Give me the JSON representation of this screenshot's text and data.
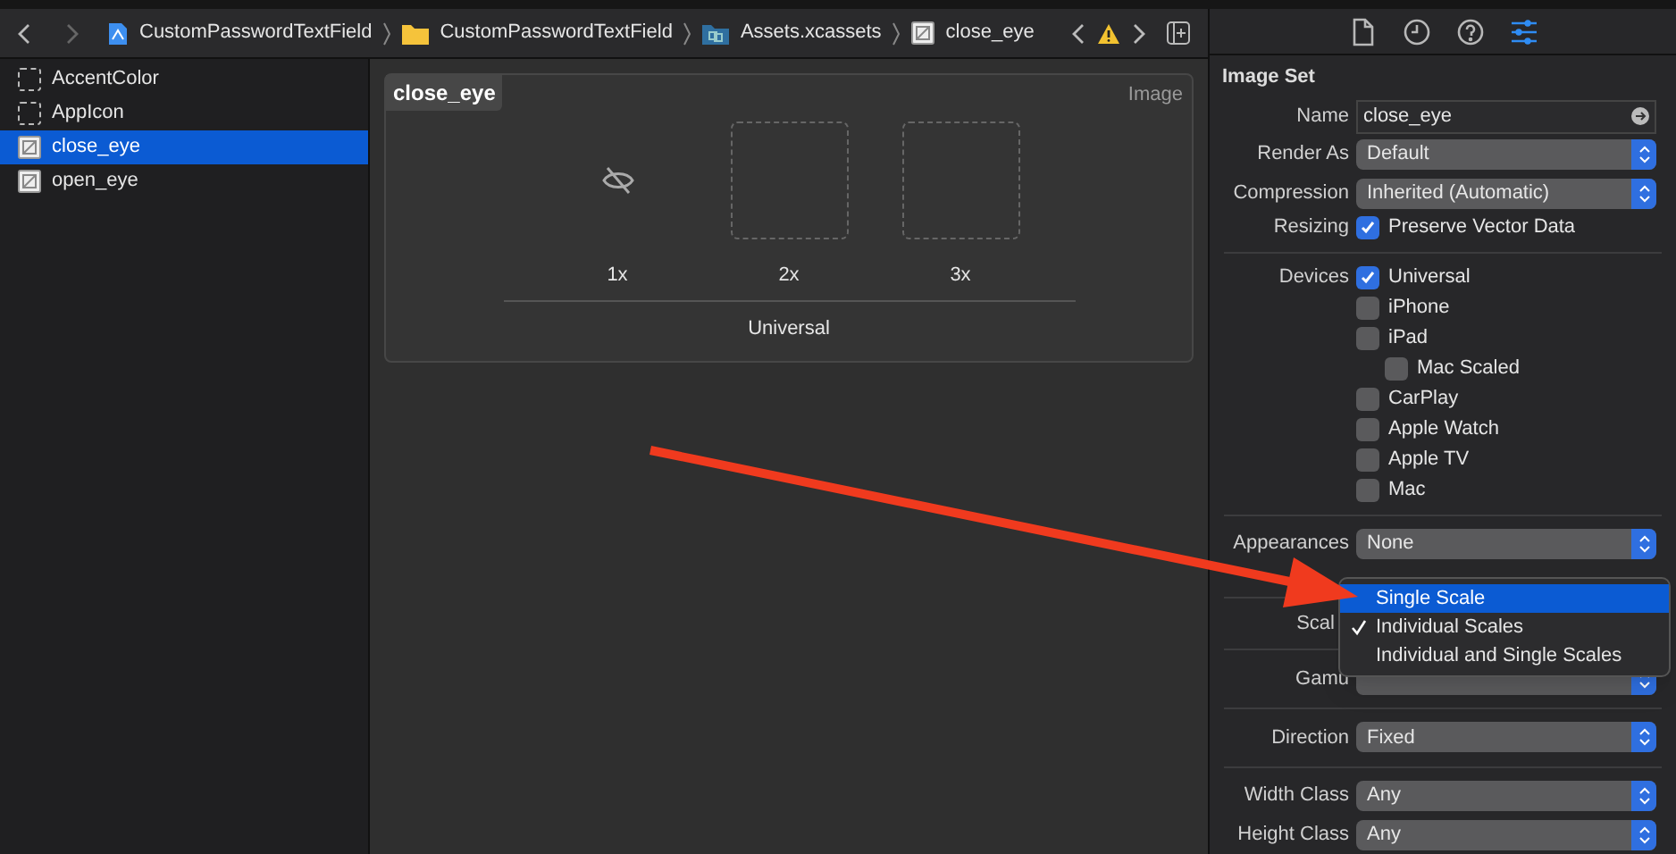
{
  "breadcrumb": [
    {
      "label": "CustomPasswordTextField",
      "kind": "project"
    },
    {
      "label": "CustomPasswordTextField",
      "kind": "folder"
    },
    {
      "label": "Assets.xcassets",
      "kind": "assets"
    },
    {
      "label": "close_eye",
      "kind": "image"
    }
  ],
  "sidebar": {
    "items": [
      {
        "label": "AccentColor",
        "kind": "empty",
        "selected": false
      },
      {
        "label": "AppIcon",
        "kind": "empty",
        "selected": false
      },
      {
        "label": "close_eye",
        "kind": "image",
        "selected": true
      },
      {
        "label": "open_eye",
        "kind": "image",
        "selected": false
      }
    ]
  },
  "editor": {
    "set_name": "close_eye",
    "type_label": "Image",
    "slots": [
      {
        "label": "1x",
        "filled": true
      },
      {
        "label": "2x",
        "filled": false
      },
      {
        "label": "3x",
        "filled": false
      }
    ],
    "group_label": "Universal"
  },
  "inspector": {
    "tabs": [
      {
        "kind": "file",
        "selected": false
      },
      {
        "kind": "history",
        "selected": false
      },
      {
        "kind": "help",
        "selected": false
      },
      {
        "kind": "attributes",
        "selected": true
      }
    ],
    "title": "Image Set",
    "rows": [
      {
        "kind": "field",
        "label": "Name",
        "value": "close_eye"
      },
      {
        "kind": "popup",
        "label": "Render As",
        "value": "Default"
      },
      {
        "kind": "popup",
        "label": "Compression",
        "value": "Inherited (Automatic)"
      },
      {
        "kind": "checkbox",
        "label": "Resizing",
        "text": "Preserve Vector Data",
        "checked": true
      },
      {
        "kind": "divider"
      },
      {
        "kind": "checkbox",
        "label": "Devices",
        "text": "Universal",
        "checked": true
      },
      {
        "kind": "checkbox",
        "text": "iPhone",
        "checked": false
      },
      {
        "kind": "checkbox",
        "text": "iPad",
        "checked": false,
        "children": [
          {
            "kind": "checkbox",
            "text": "Mac Scaled",
            "checked": false
          }
        ]
      },
      {
        "kind": "checkbox",
        "text": "CarPlay",
        "checked": false
      },
      {
        "kind": "checkbox",
        "text": "Apple Watch",
        "checked": false
      },
      {
        "kind": "checkbox",
        "text": "Apple TV",
        "checked": false
      },
      {
        "kind": "checkbox",
        "text": "Mac",
        "checked": false
      },
      {
        "kind": "divider"
      },
      {
        "kind": "popup",
        "label": "Appearances",
        "value": "None"
      },
      {
        "kind": "blank"
      },
      {
        "kind": "divider"
      },
      {
        "kind": "label",
        "label": "Scal"
      },
      {
        "kind": "divider"
      },
      {
        "kind": "popup",
        "label": "Gamu"
      },
      {
        "kind": "divider"
      },
      {
        "kind": "popup",
        "label": "Direction",
        "value": "Fixed"
      },
      {
        "kind": "divider"
      },
      {
        "kind": "popup",
        "label": "Width Class",
        "value": "Any"
      },
      {
        "kind": "popup",
        "label": "Height Class",
        "value": "Any"
      }
    ],
    "menu": [
      {
        "label": "Single Scale",
        "selected": true,
        "checked": false
      },
      {
        "label": "Individual Scales",
        "selected": false,
        "checked": true
      },
      {
        "label": "Individual and Single Scales",
        "selected": false,
        "checked": false
      }
    ]
  }
}
